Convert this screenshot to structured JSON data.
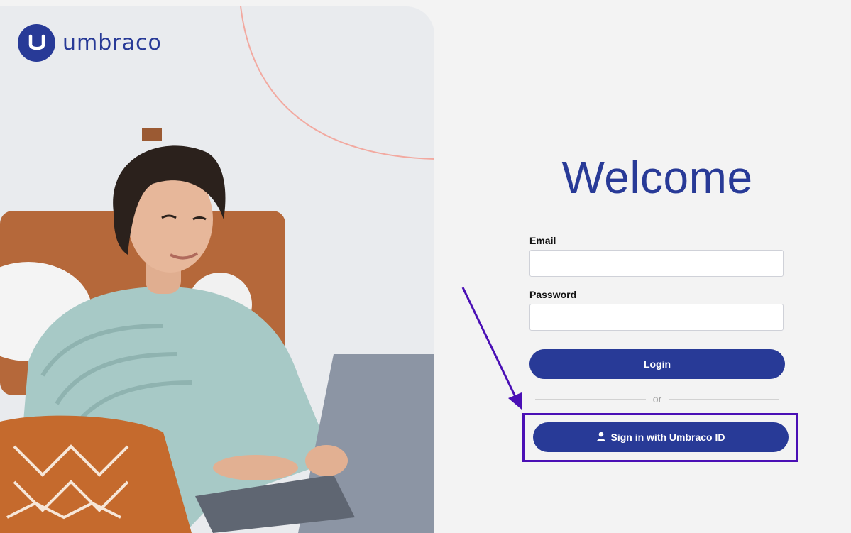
{
  "brand": {
    "name": "umbraco",
    "color": "#283a97"
  },
  "login": {
    "heading": "Welcome",
    "email_label": "Email",
    "email_value": "",
    "password_label": "Password",
    "password_value": "",
    "login_button": "Login",
    "divider_text": "or",
    "external_login_button": "Sign in with Umbraco ID"
  },
  "icons": {
    "logo": "umbraco-u-icon",
    "external_login": "user-icon",
    "annotation": "arrow-icon"
  },
  "colors": {
    "accent": "#283a97",
    "highlight_border": "#4a0fb5",
    "background": "#f3f3f3"
  }
}
